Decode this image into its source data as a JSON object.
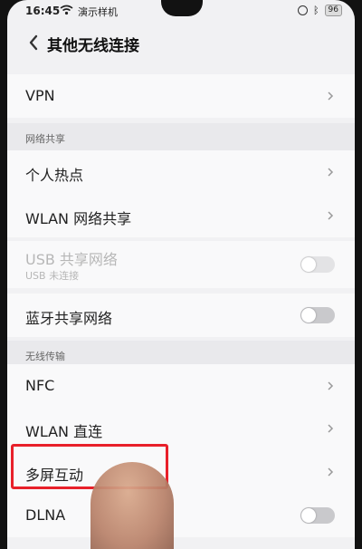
{
  "status": {
    "time": "16:45",
    "carrier": "演示样机",
    "battery": "96"
  },
  "header": {
    "title": "其他无线连接"
  },
  "rows": {
    "vpn": {
      "label": "VPN"
    },
    "hotspot": {
      "label": "个人热点"
    },
    "wlan_share": {
      "label": "WLAN 网络共享"
    },
    "usb_share": {
      "label": "USB 共享网络",
      "sub": "USB 未连接",
      "enabled": false,
      "on": false
    },
    "bt_share": {
      "label": "蓝牙共享网络",
      "on": false
    },
    "nfc": {
      "label": "NFC"
    },
    "wlan_direct": {
      "label": "WLAN 直连"
    },
    "multiscreen": {
      "label": "多屏互动"
    },
    "dlna": {
      "label": "DLNA",
      "on": false
    }
  },
  "sections": {
    "network_share": "网络共享",
    "wireless_transfer": "无线传输"
  },
  "colors": {
    "highlight": "#e8202a"
  }
}
